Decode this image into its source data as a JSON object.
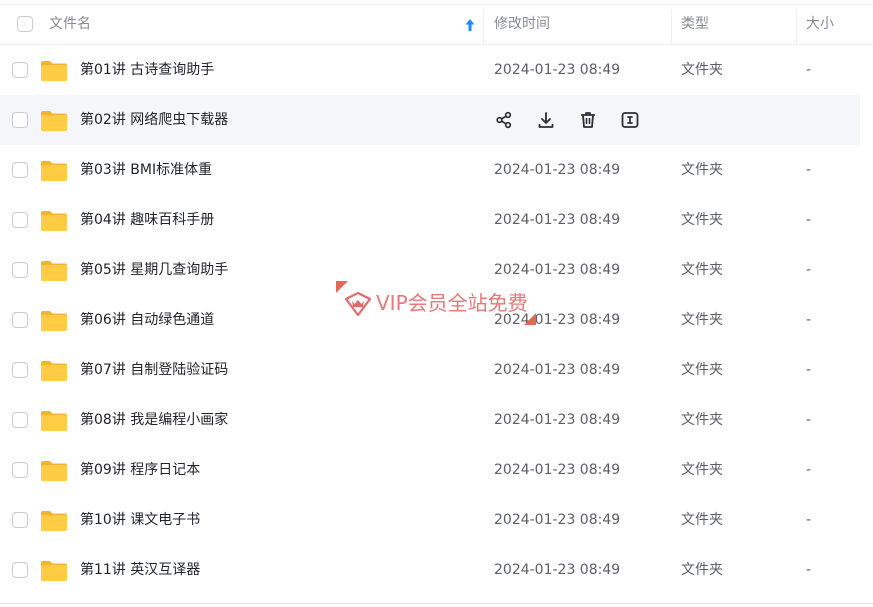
{
  "header": {
    "col_name": "文件名",
    "col_time": "修改时间",
    "col_type": "类型",
    "col_size": "大小"
  },
  "colors": {
    "accent": "#1a8cff",
    "folder": "#ffc93c",
    "hover_row": "#f5f6fa",
    "watermark": "#e36a6a"
  },
  "hover_actions": [
    "share-icon",
    "download-icon",
    "delete-icon",
    "rename-icon"
  ],
  "rows": [
    {
      "name": "第01讲 古诗查询助手",
      "time": "2024-01-23 08:49",
      "type": "文件夹",
      "size": "-"
    },
    {
      "name": "第02讲 网络爬虫下载器",
      "time": "",
      "type": "",
      "size": ""
    },
    {
      "name": "第03讲 BMI标准体重",
      "time": "2024-01-23 08:49",
      "type": "文件夹",
      "size": "-"
    },
    {
      "name": "第04讲 趣味百科手册",
      "time": "2024-01-23 08:49",
      "type": "文件夹",
      "size": "-"
    },
    {
      "name": "第05讲 星期几查询助手",
      "time": "2024-01-23 08:49",
      "type": "文件夹",
      "size": "-"
    },
    {
      "name": "第06讲 自动绿色通道",
      "time": "2024-01-23 08:49",
      "type": "文件夹",
      "size": "-"
    },
    {
      "name": "第07讲 自制登陆验证码",
      "time": "2024-01-23 08:49",
      "type": "文件夹",
      "size": "-"
    },
    {
      "name": "第08讲 我是编程小画家",
      "time": "2024-01-23 08:49",
      "type": "文件夹",
      "size": "-"
    },
    {
      "name": "第09讲 程序日记本",
      "time": "2024-01-23 08:49",
      "type": "文件夹",
      "size": "-"
    },
    {
      "name": "第10讲 课文电子书",
      "time": "2024-01-23 08:49",
      "type": "文件夹",
      "size": "-"
    },
    {
      "name": "第11讲 英汉互译器",
      "time": "2024-01-23 08:49",
      "type": "文件夹",
      "size": "-"
    }
  ],
  "watermark": {
    "text": "VIP会员全站免费"
  }
}
